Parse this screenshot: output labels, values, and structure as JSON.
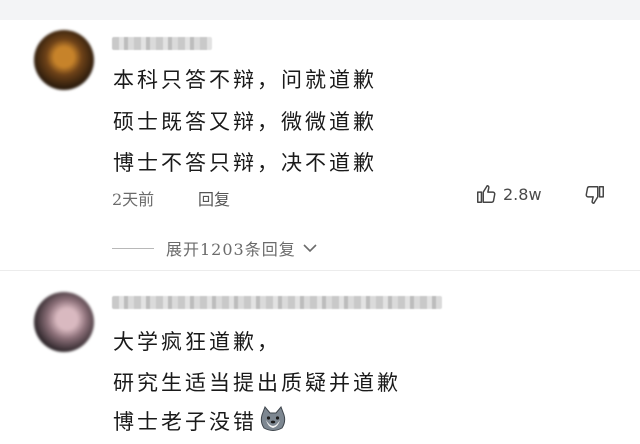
{
  "comments": [
    {
      "lines": [
        "本科只答不辩，问就道歉",
        "硕士既答又辩，微微道歉",
        "博士不答只辩，决不道歉"
      ],
      "time": "2天前",
      "reply_label": "回复",
      "likes": "2.8w",
      "expand_label": "展开1203条回复"
    },
    {
      "lines": [
        "大学疯狂道歉，",
        "研究生适当提出质疑并道歉",
        "博士老子没错"
      ],
      "emoji": "doge-icon"
    }
  ]
}
